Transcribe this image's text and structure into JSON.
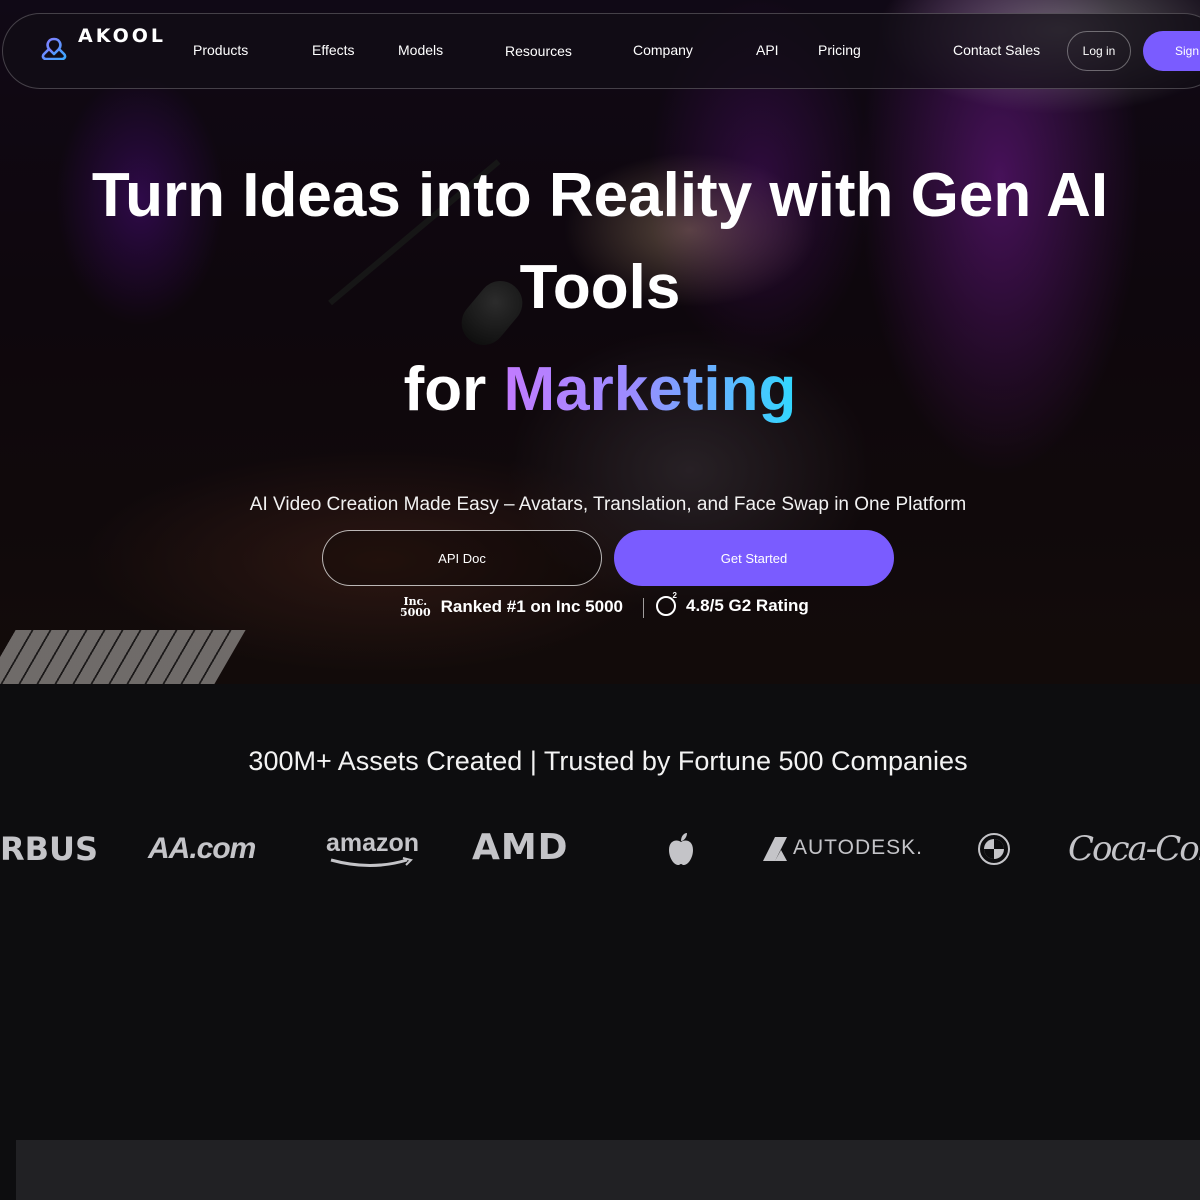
{
  "brand": {
    "name": "AKOOL",
    "accent": "#7a5cff"
  },
  "nav": {
    "items": [
      "Products",
      "Effects",
      "Models",
      "Resources",
      "Company",
      "API",
      "Pricing",
      "Contact Sales"
    ],
    "login": "Log in",
    "signup": "Sign"
  },
  "hero": {
    "headline_line1": "Turn Ideas into Reality with Gen AI",
    "headline_line2": "Tools",
    "headline_prefix": "for",
    "headline_highlight": "Marketing",
    "subtitle": "AI Video Creation Made Easy – Avatars, Translation, and Face Swap in One Platform",
    "api_button": "API Doc",
    "start_button": "Get Started",
    "badges": [
      {
        "logo": "Inc. 5000",
        "text": "Ranked #1 on Inc 5000"
      },
      {
        "logo": "g2-icon",
        "text": "4.8/5 G2 Rating"
      }
    ]
  },
  "trust": {
    "title": "300M+ Assets Created | Trusted by Fortune 500 Companies",
    "logos": [
      "RBUS",
      "AA.com",
      "amazon",
      "AMD",
      "apple-icon",
      "AUTODESK.",
      "bmw-icon",
      "Coca-Cola"
    ]
  }
}
